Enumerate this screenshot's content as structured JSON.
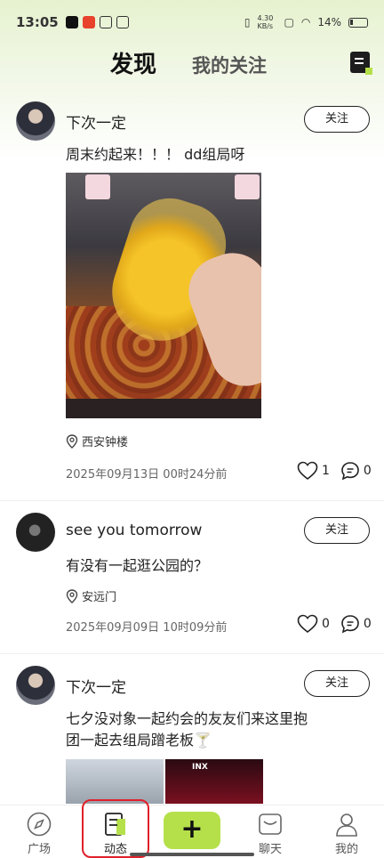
{
  "status_bar": {
    "time": "13:05",
    "net_speed": "4.30 KB/s",
    "battery": "14%"
  },
  "header": {
    "tab_discover": "发现",
    "tab_following": "我的关注"
  },
  "posts": [
    {
      "username": "下次一定",
      "follow_label": "关注",
      "text": "周末约起来！！！ dd组局呀",
      "location": "西安钟楼",
      "date": "2025年09月13日 00时24分前",
      "likes": "1",
      "comments": "0"
    },
    {
      "username": "see you tomorrow",
      "follow_label": "关注",
      "text": "有没有一起逛公园的？",
      "location": "安远门",
      "date": "2025年09月09日 10时09分前",
      "likes": "0",
      "comments": "0"
    },
    {
      "username": "下次一定",
      "follow_label": "关注",
      "text": "七夕没对象一起约会的友友们来这里抱团一起去组局蹭老板🍸",
      "image_text": "INX"
    }
  ],
  "bottom_nav": {
    "plaza": "广场",
    "moments": "动态",
    "add": "+",
    "chat": "聊天",
    "mine": "我的"
  },
  "colors": {
    "accent": "#b5e04a",
    "highlight_box": "#e0202a"
  }
}
